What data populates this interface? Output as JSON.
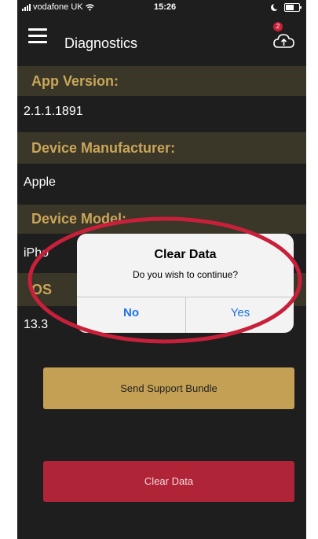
{
  "status_bar": {
    "carrier": "vodafone UK",
    "time": "15:26"
  },
  "header": {
    "title": "Diagnostics",
    "upload_badge": "2"
  },
  "rows": [
    {
      "label": "App Version:",
      "value": "2.1.1.1891"
    },
    {
      "label": "Device Manufacturer:",
      "value": "Apple"
    },
    {
      "label": "Device Model:",
      "value": "iPho"
    },
    {
      "label": "OS",
      "value": "13.3"
    }
  ],
  "buttons": {
    "support": "Send Support Bundle",
    "clear": "Clear Data"
  },
  "dialog": {
    "title": "Clear Data",
    "message": "Do you wish to continue?",
    "no": "No",
    "yes": "Yes"
  },
  "colors": {
    "label_gold": "#c9a659",
    "support_button": "#c4a054",
    "clear_button": "#b02437",
    "annotation_ring": "#c8203a",
    "dialog_link": "#1a73e8"
  },
  "icons": [
    "menu-icon",
    "cloud-upload-icon",
    "signal-icon",
    "wifi-icon",
    "moon-icon",
    "battery-icon"
  ]
}
